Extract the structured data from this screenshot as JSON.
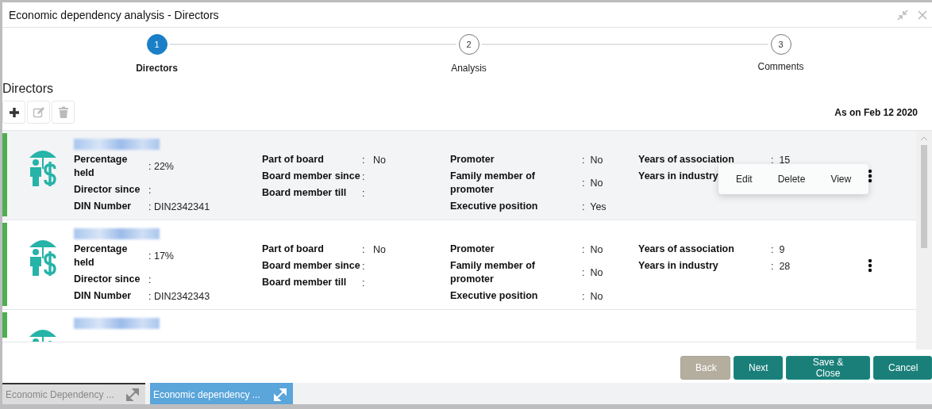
{
  "window": {
    "title": "Economic dependency analysis - Directors"
  },
  "steps": [
    {
      "number": "1",
      "label": "Directors",
      "selected": true
    },
    {
      "number": "2",
      "label": "Analysis",
      "selected": false
    },
    {
      "number": "3",
      "label": "Comments",
      "selected": false
    }
  ],
  "section_title": "Directors",
  "toolbar": [
    {
      "kind": "add",
      "disabled": false
    },
    {
      "kind": "edit",
      "disabled": true
    },
    {
      "kind": "delete",
      "disabled": true
    }
  ],
  "as_on": "As on Feb 12 2020",
  "directors": [
    {
      "highlighted": true,
      "columns": [
        [
          {
            "label": "Percentage held",
            "value": ": 22%"
          },
          {
            "label": "Director since",
            "value": ":"
          },
          {
            "label": "DIN Number",
            "value": ": DIN2342341"
          }
        ],
        [
          {
            "label": "Part of board",
            "value": ":   No"
          },
          {
            "label": "Board member since",
            "value": ":"
          },
          {
            "label": "Board member till",
            "value": ":"
          }
        ],
        [
          {
            "label": "Promoter",
            "value": ":  No"
          },
          {
            "label": "Family member of promoter",
            "value": ":  No"
          },
          {
            "label": "Executive position",
            "value": ":  Yes"
          }
        ],
        [
          {
            "label": "Years of association",
            "value": ":  15"
          },
          {
            "label": "Years in industry"
          }
        ]
      ],
      "menu": [
        "Edit",
        "Delete",
        "View"
      ]
    },
    {
      "highlighted": false,
      "columns": [
        [
          {
            "label": "Percentage held",
            "value": ": 17%"
          },
          {
            "label": "Director since",
            "value": ":"
          },
          {
            "label": "DIN Number",
            "value": ": DIN2342343"
          }
        ],
        [
          {
            "label": "Part of board",
            "value": ":   No"
          },
          {
            "label": "Board member since",
            "value": ":"
          },
          {
            "label": "Board member till",
            "value": ":"
          }
        ],
        [
          {
            "label": "Promoter",
            "value": ":  No"
          },
          {
            "label": "Family member of promoter",
            "value": ":  No"
          },
          {
            "label": "Executive position",
            "value": ":  No"
          }
        ],
        [
          {
            "label": "Years of association",
            "value": ":  9"
          },
          {
            "label": "Years in industry",
            "value": ":  28"
          }
        ]
      ]
    },
    {
      "highlighted": false
    }
  ],
  "buttons": [
    {
      "label": "Back",
      "disabled": true
    },
    {
      "label": "Next",
      "disabled": false
    },
    {
      "label": "Save & Close",
      "disabled": false
    },
    {
      "label": "Cancel",
      "disabled": false
    }
  ],
  "taskbar": [
    {
      "label": "Economic Dependency ...",
      "selected": false
    },
    {
      "label": "Economic dependency ...",
      "selected": true
    }
  ]
}
